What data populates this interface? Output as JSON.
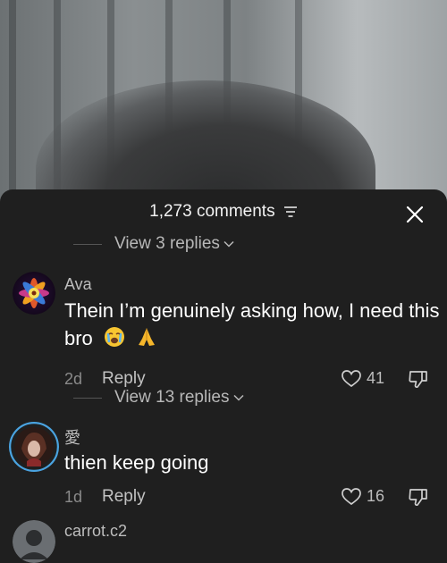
{
  "header": {
    "comment_count": "1,273 comments"
  },
  "threads": [
    {
      "view_replies": "View 3 replies"
    },
    {
      "username": "Ava",
      "text": "Thein I’m genuinely asking how, I need this bro",
      "emojis": [
        "crying-face",
        "folded-hands"
      ],
      "age": "2d",
      "reply_label": "Reply",
      "likes": "41",
      "view_replies": "View 13 replies"
    },
    {
      "username": "愛",
      "text": "thien keep going",
      "age": "1d",
      "reply_label": "Reply",
      "likes": "16"
    },
    {
      "username": "carrot.c2"
    }
  ],
  "colors": {
    "background": "#1f1f1f",
    "muted": "#8a8a8a",
    "story_ring": "#4aa3e0"
  }
}
